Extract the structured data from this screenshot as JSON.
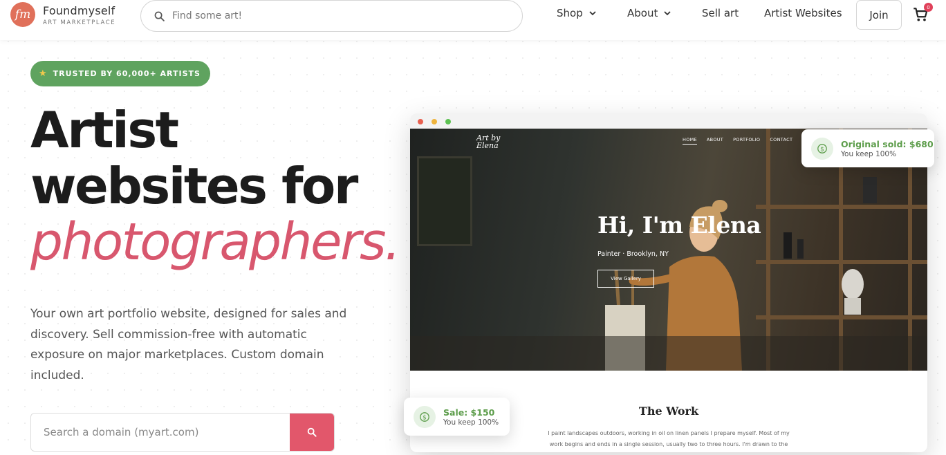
{
  "header": {
    "logo_mark": "fm",
    "logo_name": "Foundmyself",
    "logo_tagline": "ART MARKETPLACE",
    "search_placeholder": "Find some art!",
    "nav": {
      "shop": "Shop",
      "about": "About",
      "sell_art": "Sell art",
      "artist_websites": "Artist Websites"
    },
    "join_label": "Join",
    "cart_count": "0"
  },
  "hero": {
    "badge": "TRUSTED BY 60,000+ ARTISTS",
    "title_line1": "Artist",
    "title_line2": "websites for",
    "title_line3": "photographers.",
    "description": "Your own art portfolio website, designed for sales and discovery. Sell commission-free with automatic exposure on major marketplaces. Custom domain included.",
    "domain_placeholder": "Search a domain (myart.com)"
  },
  "preview": {
    "site_logo_line1": "Art by",
    "site_logo_line2": "Elena",
    "site_nav": [
      "HOME",
      "ABOUT",
      "PORTFOLIO",
      "CONTACT"
    ],
    "hero_title": "Hi, I'm Elena",
    "hero_subtitle": "Painter · Brooklyn, NY",
    "hero_button": "View Gallery",
    "section_title": "The Work",
    "section_text": "I paint landscapes outdoors, working in oil on linen panels I prepare myself. Most of my work begins and ends in a single session, usually two to three hours. I'm drawn to the"
  },
  "cards": {
    "original": {
      "title": "Original sold: $680",
      "sub": "You keep 100%"
    },
    "sale": {
      "title": "Sale: $150",
      "sub": "You keep 100%"
    }
  },
  "colors": {
    "accent_pink": "#d8576e",
    "badge_green": "#5fa35f",
    "money_green": "#5d9d4b",
    "search_button": "#e2576b"
  }
}
